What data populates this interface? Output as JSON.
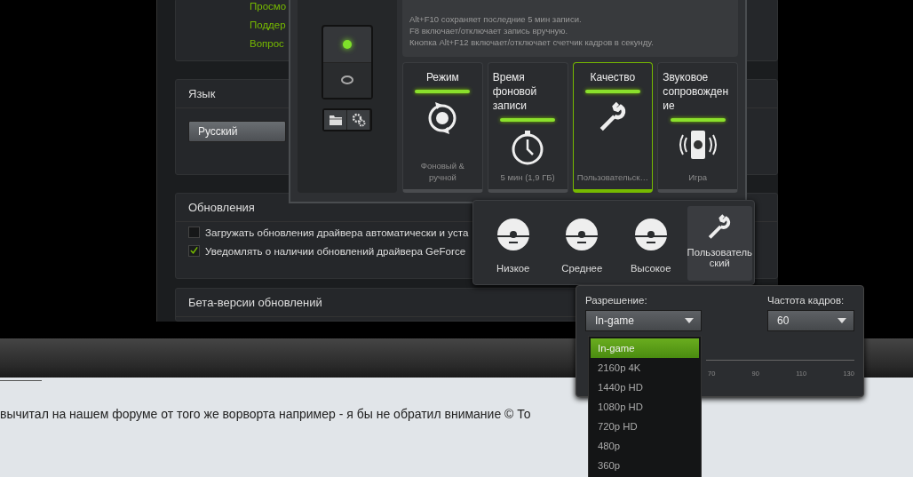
{
  "settings": {
    "links": [
      "Просмо",
      "Поддер",
      "Вопрос"
    ],
    "language": {
      "title": "Язык",
      "value": "Русский"
    },
    "updates": {
      "title": "Обновления",
      "options": [
        {
          "label": "Загружать обновления драйвера автоматически и уста",
          "checked": false
        },
        {
          "label": "Уведомлять о наличии обновлений драйвера GeForce",
          "checked": true
        }
      ]
    },
    "beta_title": "Бета-версии обновлений"
  },
  "shadowplay": {
    "switch_on": true,
    "hint_lines": [
      "Alt+F10 сохраняет последние 5 мин записи.",
      "F8 включает/отключает запись вручную.",
      "Кнопка Alt+F12 включает/отключает счетчик кадров в секунду."
    ],
    "tiles": [
      {
        "title": "Режим",
        "value": "Фоновый & ручной",
        "kind": "mode",
        "selected": false
      },
      {
        "title": "Время фоновой записи",
        "value": "5 мин (1,9 ГБ)",
        "kind": "timer",
        "selected": false
      },
      {
        "title": "Качество",
        "value": "Пользовательск…",
        "kind": "quality",
        "selected": true
      },
      {
        "title": "Звуковое сопровождение",
        "value": "Игра",
        "kind": "audio",
        "selected": false
      }
    ]
  },
  "quality_menu": {
    "options": [
      {
        "label": "Низкое",
        "kind": "gauge",
        "selected": false
      },
      {
        "label": "Среднее",
        "kind": "gauge",
        "selected": false
      },
      {
        "label": "Высокое",
        "kind": "gauge",
        "selected": false
      },
      {
        "label": "Пользовательский",
        "kind": "custom",
        "selected": true
      }
    ]
  },
  "custom": {
    "resolution_label": "Разрешение:",
    "resolution_value": "In-game",
    "fps_label": "Частота кадров:",
    "fps_value": "60",
    "scale_ticks": [
      "70",
      "90",
      "110",
      "130"
    ],
    "resolution_options": [
      {
        "label": "In-game",
        "selected": true
      },
      {
        "label": "2160p 4K",
        "selected": false
      },
      {
        "label": "1440p HD",
        "selected": false
      },
      {
        "label": "1080p HD",
        "selected": false
      },
      {
        "label": "720p HD",
        "selected": false
      },
      {
        "label": "480p",
        "selected": false
      },
      {
        "label": "360p",
        "selected": false
      }
    ]
  },
  "forum_text": "вычитал на нашем форуме от того же ворворта например - я бы не обратил внимание © То"
}
